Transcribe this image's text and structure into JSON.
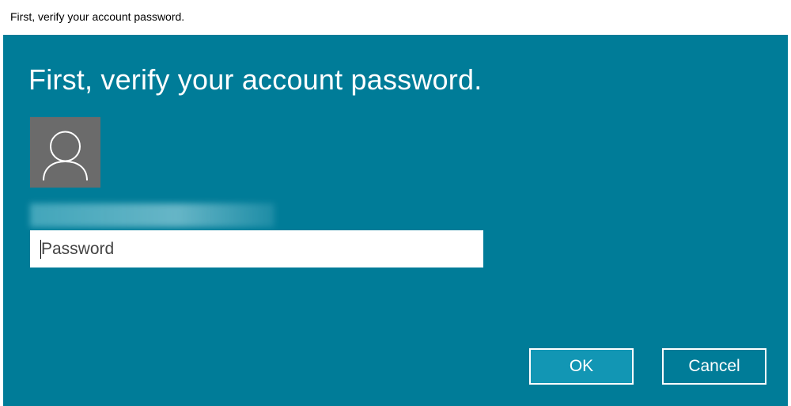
{
  "window": {
    "title": "First, verify your account password."
  },
  "dialog": {
    "heading": "First, verify your account password.",
    "avatar_icon": "user-icon",
    "account_name": "",
    "password": {
      "value": "",
      "placeholder": "Password"
    },
    "ok_label": "OK",
    "cancel_label": "Cancel"
  },
  "colors": {
    "background": "#007c98",
    "ok_button": "#1296b4",
    "cancel_button": "#007c98",
    "avatar_background": "#6b6b6b",
    "text": "#ffffff"
  }
}
